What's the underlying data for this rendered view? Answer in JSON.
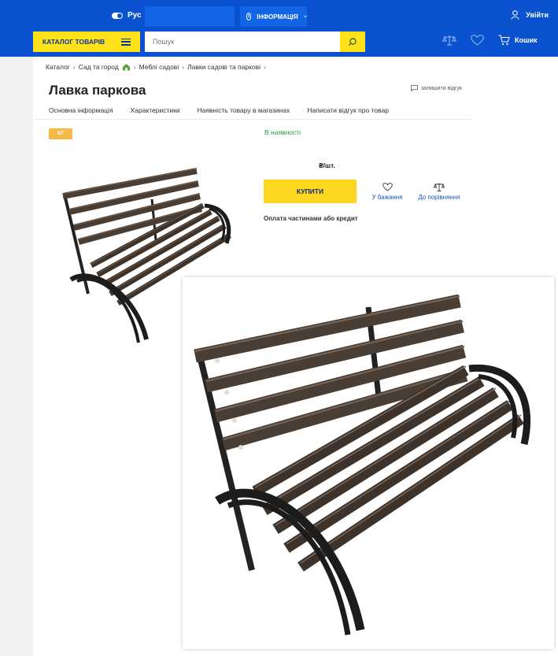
{
  "header": {
    "language": "Рус",
    "info_label": "ІНФОРМАЦІЯ",
    "login_label": "Увійти",
    "catalog_label": "КАТАЛОГ ТОВАРІВ",
    "search_placeholder": "Пошук",
    "cart_label": "Кошик"
  },
  "breadcrumb": [
    "Каталог",
    "Сад та город",
    "Меблі садові",
    "Лавки садові та паркові"
  ],
  "product": {
    "title": "Лавка паркова",
    "review_link": "залишити відгук",
    "badge": "BT",
    "availability": "В наявності",
    "price_unit": "₴/шт.",
    "buy_label": "КУПИТИ",
    "wishlist_label": "У бажання",
    "compare_label": "До порівняння",
    "credit_text": "Оплата частинами або кредит"
  },
  "tabs": [
    "Основна інформація",
    "Характеристики",
    "Наявність товару в магазинах",
    "Написати відгук про товар"
  ],
  "colors": {
    "header_blue": "#0b52d1",
    "accent_yellow": "#ffe11a",
    "stock_green": "#1e9a36",
    "badge_orange": "#f7b945",
    "link_blue": "#1a56c4"
  },
  "icons": [
    "toggle-icon",
    "info-icon",
    "chevron-down-icon",
    "user-icon",
    "menu-icon",
    "search-icon",
    "scales-icon",
    "heart-icon",
    "cart-icon",
    "home-icon",
    "comment-icon"
  ]
}
